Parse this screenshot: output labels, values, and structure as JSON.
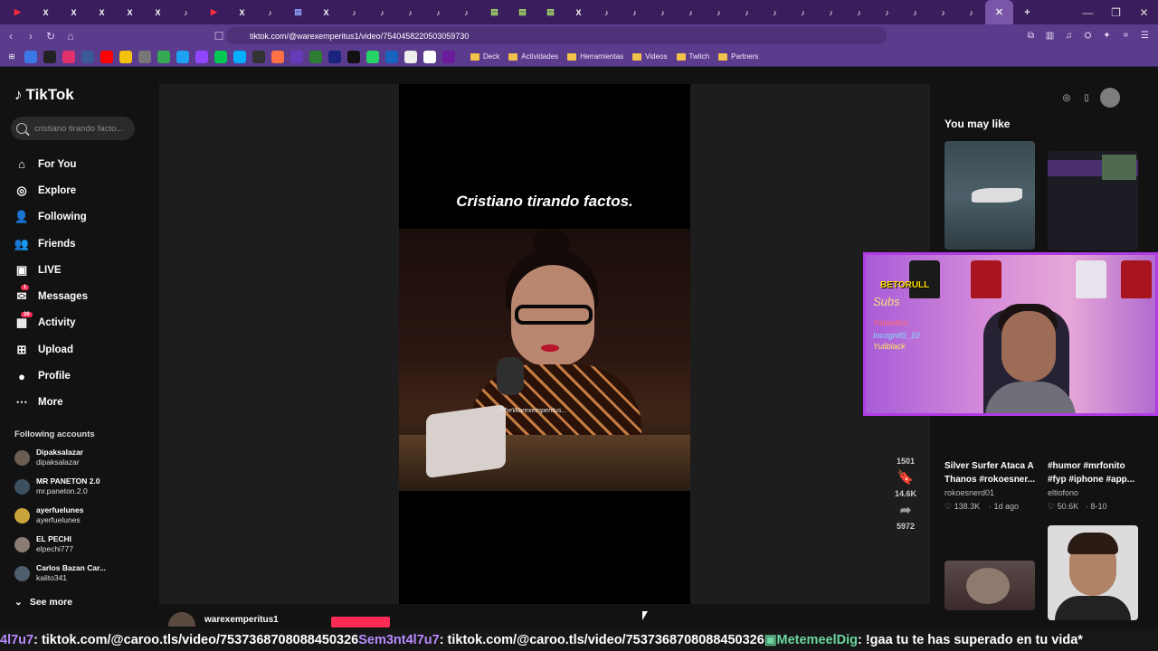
{
  "browser": {
    "tabs": [
      {
        "icon": "youtube-icon",
        "glyph": "▶",
        "color": "#ff2d3b"
      },
      {
        "icon": "x-icon",
        "glyph": "X",
        "color": "#ffffff"
      },
      {
        "icon": "x-icon",
        "glyph": "X",
        "color": "#ffffff"
      },
      {
        "icon": "x-icon",
        "glyph": "X",
        "color": "#ffffff"
      },
      {
        "icon": "x-icon",
        "glyph": "X",
        "color": "#ffffff"
      },
      {
        "icon": "x-icon",
        "glyph": "X",
        "color": "#ffffff"
      },
      {
        "icon": "tiktok-icon",
        "glyph": "♪",
        "color": "#ffffff"
      },
      {
        "icon": "youtube-icon",
        "glyph": "▶",
        "color": "#ff2d3b"
      },
      {
        "icon": "x-icon",
        "glyph": "X",
        "color": "#ffffff"
      },
      {
        "icon": "tiktok-icon",
        "glyph": "♪",
        "color": "#ffffff"
      },
      {
        "icon": "generic-page-icon",
        "glyph": "▤",
        "color": "#8fa8ff"
      },
      {
        "icon": "x-icon",
        "glyph": "X",
        "color": "#ffffff"
      },
      {
        "icon": "tiktok-icon",
        "glyph": "♪",
        "color": "#ffffff"
      },
      {
        "icon": "tiktok-icon",
        "glyph": "♪",
        "color": "#ffffff"
      },
      {
        "icon": "tiktok-icon",
        "glyph": "♪",
        "color": "#ffffff"
      },
      {
        "icon": "tiktok-icon",
        "glyph": "♪",
        "color": "#ffffff"
      },
      {
        "icon": "tiktok-icon",
        "glyph": "♪",
        "color": "#ffffff"
      },
      {
        "icon": "generic-page-icon",
        "glyph": "▤",
        "color": "#a5e06a"
      },
      {
        "icon": "generic-page-icon",
        "glyph": "▤",
        "color": "#a5e06a"
      },
      {
        "icon": "generic-page-icon",
        "glyph": "▤",
        "color": "#a5e06a"
      },
      {
        "icon": "x-icon",
        "glyph": "X",
        "color": "#ffffff"
      },
      {
        "icon": "tiktok-icon",
        "glyph": "♪",
        "color": "#ffffff"
      },
      {
        "icon": "tiktok-icon",
        "glyph": "♪",
        "color": "#ffffff"
      },
      {
        "icon": "tiktok-icon",
        "glyph": "♪",
        "color": "#ffffff"
      },
      {
        "icon": "tiktok-icon",
        "glyph": "♪",
        "color": "#ffffff"
      },
      {
        "icon": "tiktok-icon",
        "glyph": "♪",
        "color": "#ffffff"
      },
      {
        "icon": "tiktok-icon",
        "glyph": "♪",
        "color": "#ffffff"
      },
      {
        "icon": "tiktok-icon",
        "glyph": "♪",
        "color": "#ffffff"
      },
      {
        "icon": "tiktok-icon",
        "glyph": "♪",
        "color": "#ffffff"
      },
      {
        "icon": "tiktok-icon",
        "glyph": "♪",
        "color": "#ffffff"
      },
      {
        "icon": "tiktok-icon",
        "glyph": "♪",
        "color": "#ffffff"
      },
      {
        "icon": "tiktok-icon",
        "glyph": "♪",
        "color": "#ffffff"
      },
      {
        "icon": "tiktok-icon",
        "glyph": "♪",
        "color": "#ffffff"
      },
      {
        "icon": "tiktok-icon",
        "glyph": "♪",
        "color": "#ffffff"
      },
      {
        "icon": "tiktok-icon",
        "glyph": "♪",
        "color": "#ffffff"
      }
    ],
    "close_tab": "✕",
    "new_tab": "+",
    "url": "tiktok.com/@warexemperitus1/video/7540458220503059730",
    "bookmarks": {
      "folders": [
        "Deck",
        "Actividades",
        "Herramientas",
        "Videos",
        "Twitch",
        "Partners"
      ]
    }
  },
  "tiktok": {
    "logo": "TikTok",
    "search_placeholder": "cristiano tirando facto...",
    "nav": [
      {
        "label": "For You",
        "icon": "home-icon",
        "glyph": "⌂"
      },
      {
        "label": "Explore",
        "icon": "compass-icon",
        "glyph": "◎"
      },
      {
        "label": "Following",
        "icon": "following-icon",
        "glyph": "👤"
      },
      {
        "label": "Friends",
        "icon": "friends-icon",
        "glyph": "👥"
      },
      {
        "label": "LIVE",
        "icon": "live-icon",
        "glyph": "▣"
      },
      {
        "label": "Messages",
        "icon": "messages-icon",
        "glyph": "✉",
        "badge": "1"
      },
      {
        "label": "Activity",
        "icon": "activity-icon",
        "glyph": "▦",
        "badge": "26"
      },
      {
        "label": "Upload",
        "icon": "upload-icon",
        "glyph": "⊞"
      },
      {
        "label": "Profile",
        "icon": "profile-icon",
        "glyph": "●"
      },
      {
        "label": "More",
        "icon": "more-icon",
        "glyph": "⋯"
      }
    ],
    "following_title": "Following accounts",
    "following": [
      {
        "name": "Dipaksalazar",
        "user": "dipaksalazar"
      },
      {
        "name": "MR PANETON 2.0",
        "user": "mr.paneton.2.0"
      },
      {
        "name": "ayerfuelunes",
        "user": "ayerfuelunes"
      },
      {
        "name": "EL PECHI",
        "user": "elpechi777"
      },
      {
        "name": "Carlos Bazan Car...",
        "user": "kalito341"
      }
    ],
    "see_more": "See more",
    "video": {
      "caption": "Cristiano tirando factos.",
      "watermark": "/TheWarexemperitus...",
      "username": "warexemperitus1"
    },
    "actions": [
      {
        "count": "1501",
        "icon": "comment-icon",
        "glyph": ""
      },
      {
        "count": "14.6K",
        "icon": "bookmark-icon",
        "glyph": "🔖"
      },
      {
        "count": "5972",
        "icon": "share-icon",
        "glyph": "➦"
      }
    ],
    "you_may_like": "You may like",
    "recommendations": [
      {
        "title": "Silver Surfer Ataca A Thanos #rokoesner...",
        "user": "rokoesnerd01",
        "likes": "♡ 138.3K",
        "date": "· 1d ago"
      },
      {
        "title": "#humor #mrfonito #fyp #iphone #app...",
        "user": "eltiofono",
        "likes": "♡ 50.6K",
        "date": "· 8-10"
      }
    ]
  },
  "stream_overlay": {
    "logo": "BETORULL",
    "subs_label": "Subs",
    "subs": [
      "Yolwelton",
      "Incognit0_10",
      "Yuliblack"
    ]
  },
  "chat_ticker": [
    {
      "user": "4l7u7",
      "msg": " : tiktok.com/@caroo.tls/video/7537368708088450326 "
    },
    {
      "user": "Sem3nt4l7u7",
      "msg": " : tiktok.com/@caroo.tls/video/7537368708088450326 "
    },
    {
      "user": "MetemeelDig",
      "msg": " : !gaa tu te has superado en tu vida*"
    }
  ]
}
